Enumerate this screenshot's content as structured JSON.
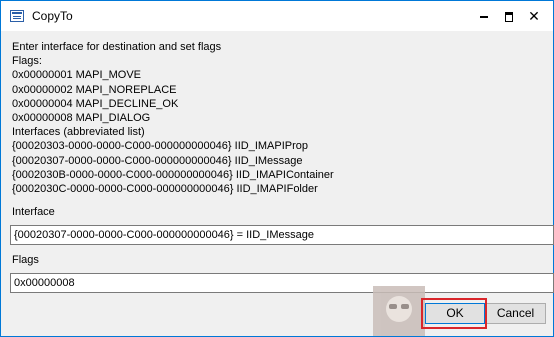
{
  "window": {
    "title": "CopyTo"
  },
  "info_lines": [
    "Enter interface for destination and set flags",
    "Flags:",
    "0x00000001 MAPI_MOVE",
    "0x00000002 MAPI_NOREPLACE",
    "0x00000004 MAPI_DECLINE_OK",
    "0x00000008 MAPI_DIALOG",
    "Interfaces (abbreviated list)",
    "{00020303-0000-0000-C000-000000000046} IID_IMAPIProp",
    "{00020307-0000-0000-C000-000000000046} IID_IMessage",
    "{0002030B-0000-0000-C000-000000000046} IID_IMAPIContainer",
    "{0002030C-0000-0000-C000-000000000046} IID_IMAPIFolder"
  ],
  "interface": {
    "label": "Interface",
    "value": "{00020307-0000-0000-C000-000000000046} = IID_IMessage"
  },
  "flags": {
    "label": "Flags",
    "value": "0x00000008"
  },
  "buttons": {
    "ok": "OK",
    "cancel": "Cancel"
  },
  "colors": {
    "accent": "#0078d7",
    "highlight": "#d9262b"
  },
  "icons": {
    "app": "window-icon",
    "minimize": "minimize-icon",
    "maximize": "maximize-icon",
    "close": "close-icon"
  }
}
